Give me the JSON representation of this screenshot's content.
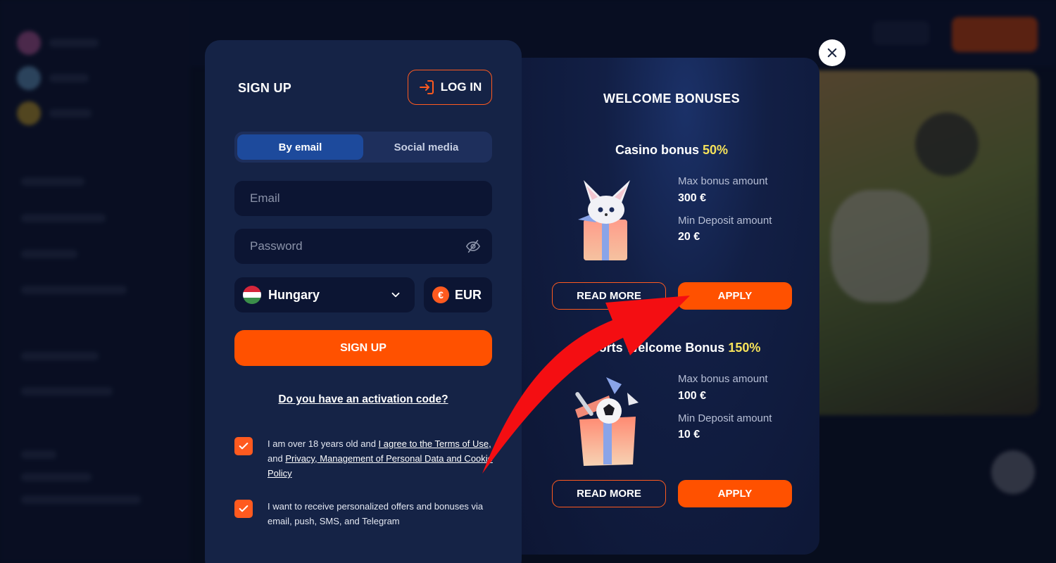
{
  "signup": {
    "title": "SIGN UP",
    "login_label": "LOG IN",
    "tabs": [
      {
        "label": "By email",
        "active": true
      },
      {
        "label": "Social media",
        "active": false
      }
    ],
    "email_placeholder": "Email",
    "password_placeholder": "Password",
    "country": "Hungary",
    "currency": "EUR",
    "currency_symbol": "€",
    "submit_label": "SIGN UP",
    "activation_link": "Do you have an activation code?",
    "consent_terms": {
      "prefix": "I am over 18 years old and ",
      "terms_link": "I agree to the Terms of Use,",
      "middle": " and ",
      "privacy_link": "Privacy, Management of Personal Data and Cookie Policy",
      "checked": true
    },
    "consent_marketing": {
      "text": "I want to receive personalized offers and bonuses via email, push, SMS, and Telegram",
      "checked": true
    }
  },
  "bonuses": {
    "heading": "WELCOME BONUSES",
    "items": [
      {
        "title": "Casino bonus",
        "percent": "50%",
        "max_label": "Max bonus amount",
        "max_value": "300 €",
        "min_label": "Min Deposit amount",
        "min_value": "20 €",
        "read_more": "READ MORE",
        "apply": "APPLY"
      },
      {
        "title": "Sports Welcome Bonus",
        "percent": "150%",
        "max_label": "Max bonus amount",
        "max_value": "100 €",
        "min_label": "Min Deposit amount",
        "min_value": "10 €",
        "read_more": "READ MORE",
        "apply": "APPLY"
      }
    ]
  },
  "colors": {
    "accent": "#ff5100",
    "highlight": "#f7e35a",
    "panel": "#152346"
  },
  "icons": [
    "login-icon",
    "eye-off-icon",
    "chevron-down-icon",
    "check-icon",
    "close-icon",
    "hungary-flag-icon",
    "euro-icon"
  ]
}
